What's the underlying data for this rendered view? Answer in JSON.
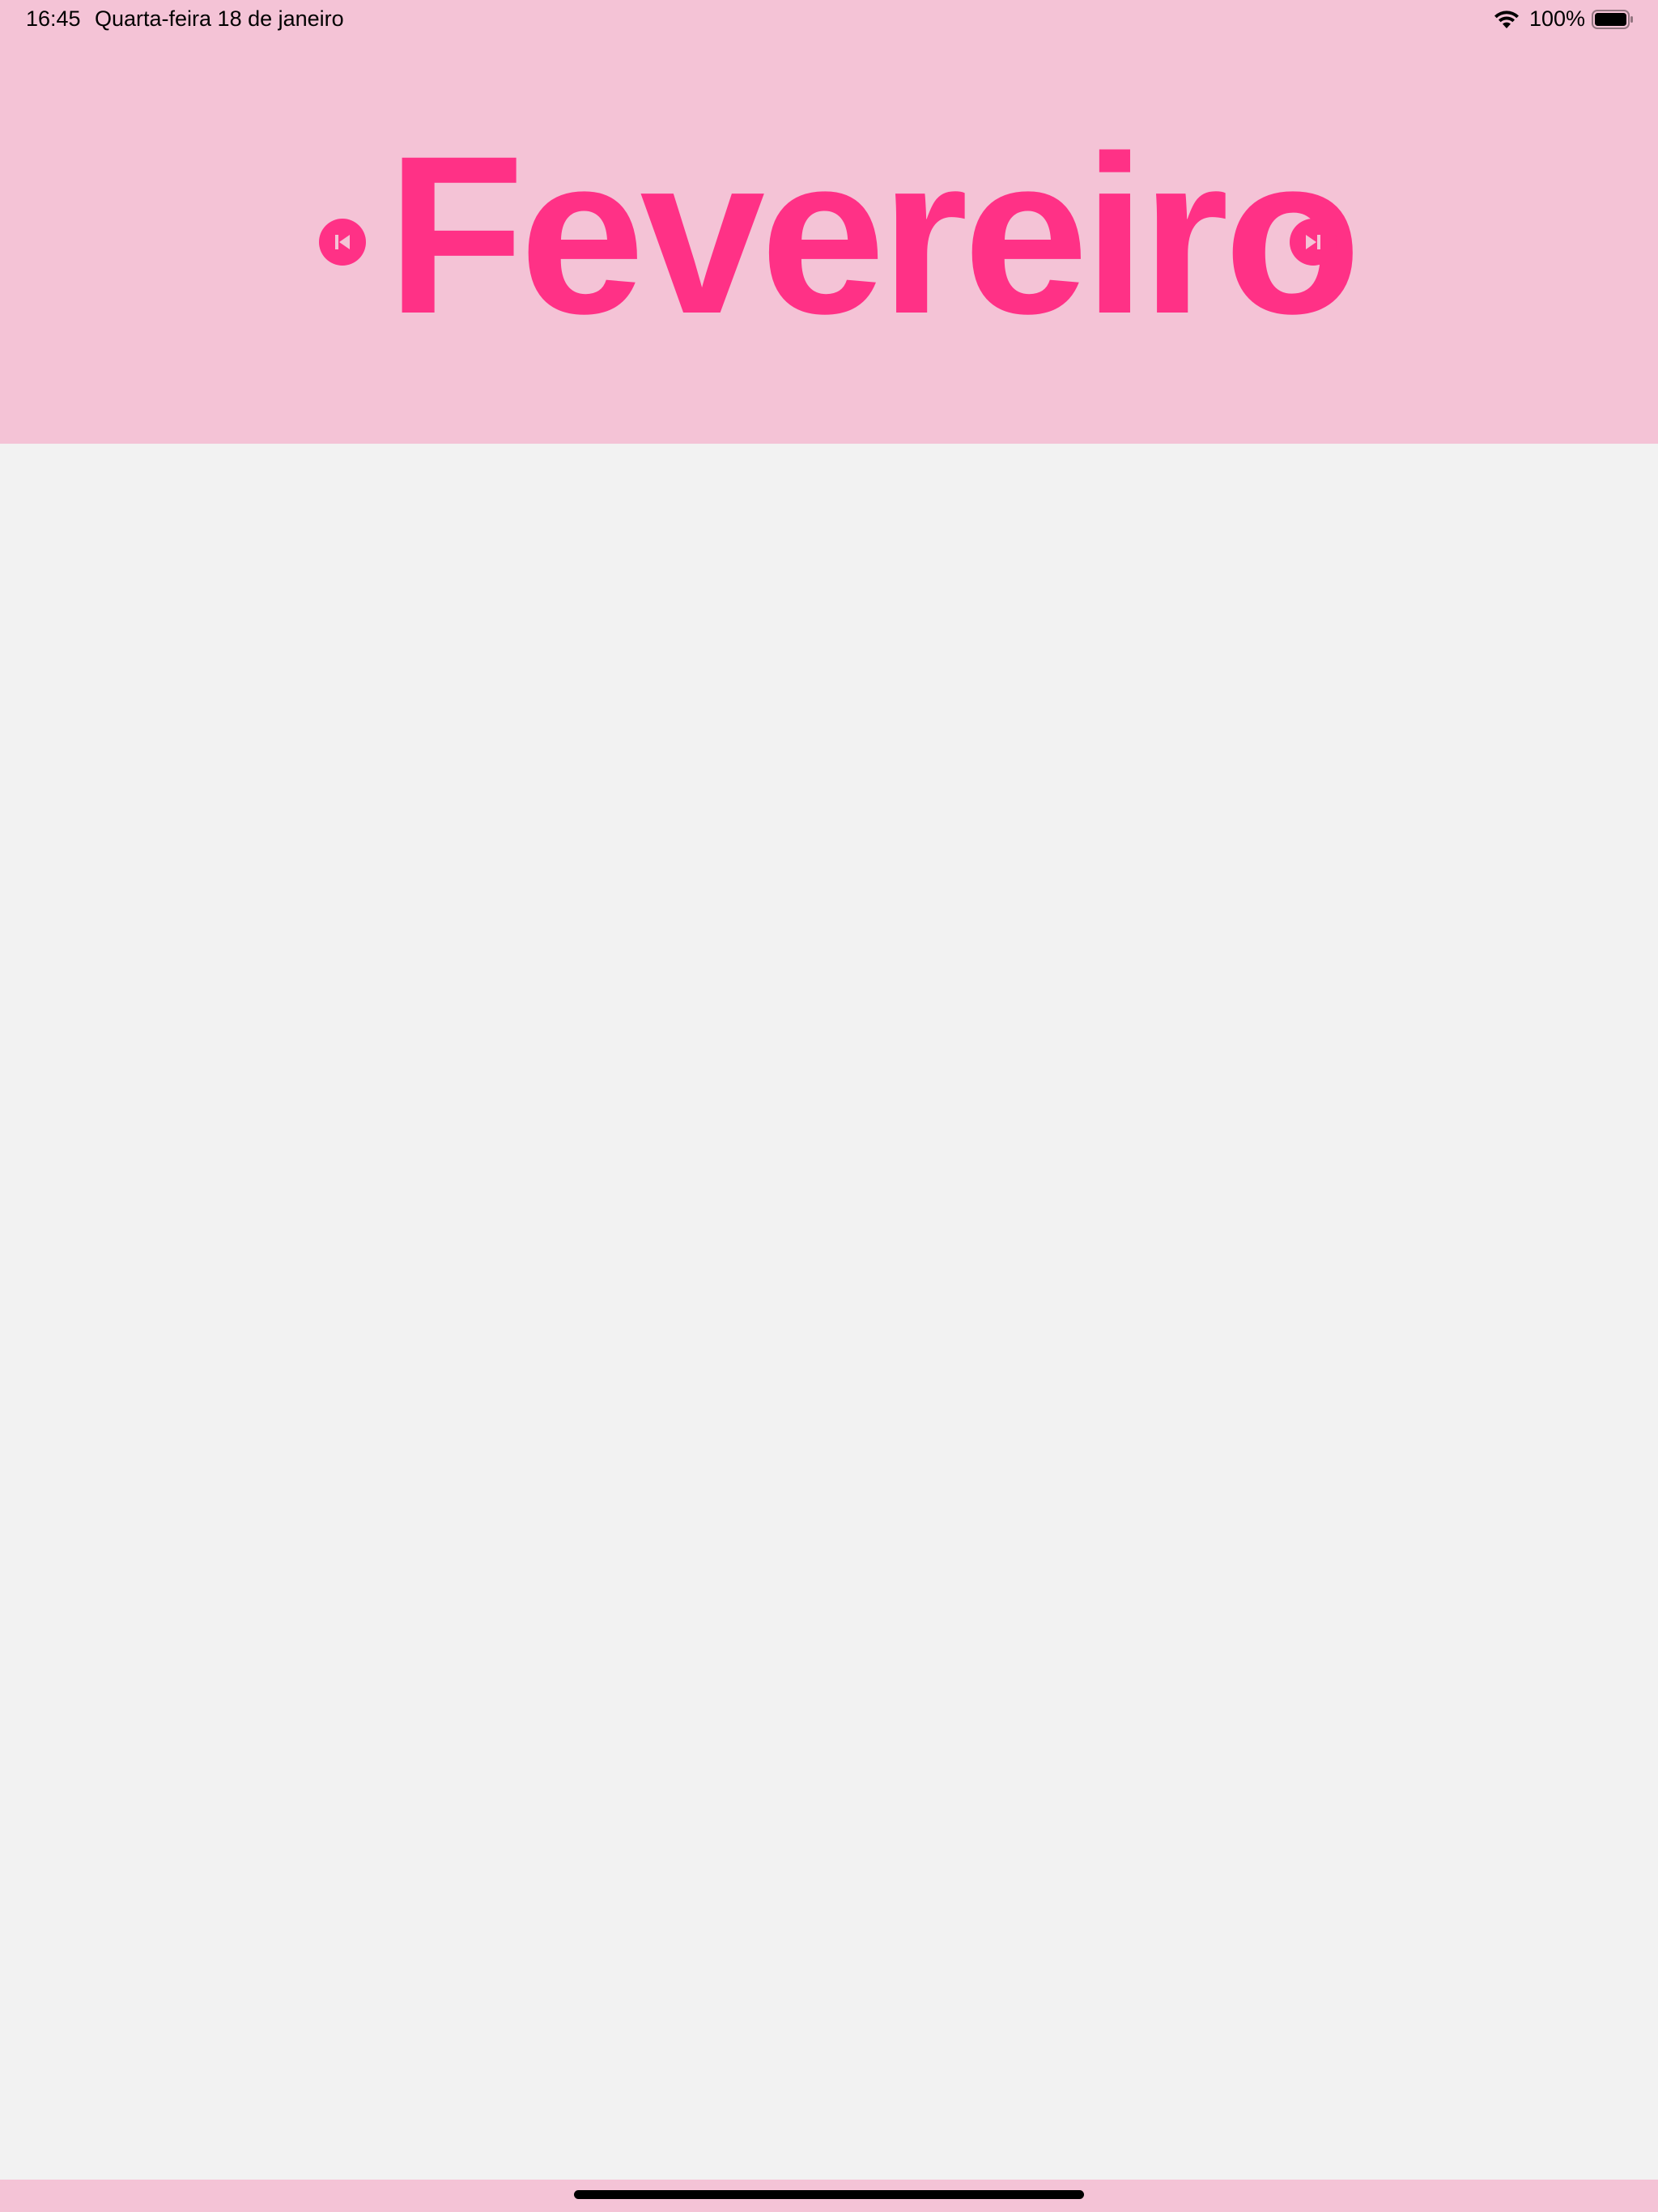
{
  "status_bar": {
    "time": "16:45",
    "date": "Quarta-feira 18 de janeiro",
    "battery_percent": "100%",
    "wifi_icon": "wifi-icon",
    "battery_icon": "battery-full-icon"
  },
  "calendar": {
    "month_title": "Fevereiro",
    "prev_icon": "skip-back-icon",
    "next_icon": "skip-forward-icon"
  },
  "colors": {
    "header_background": "#f4c3d6",
    "accent": "#ff3186",
    "content_background": "#f2f2f2"
  }
}
